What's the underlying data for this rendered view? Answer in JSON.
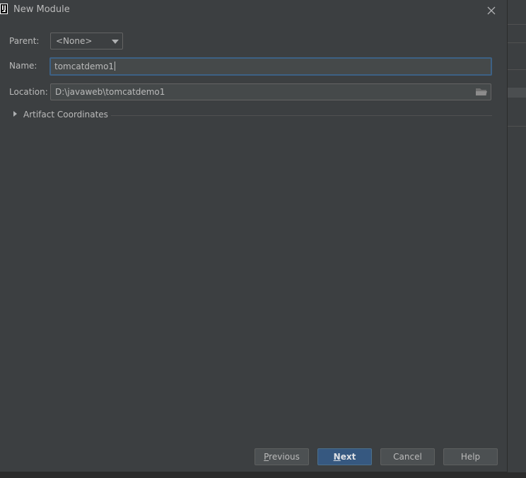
{
  "window": {
    "title": "New Module",
    "app_icon": "intellij-logo-icon"
  },
  "form": {
    "parent_label": "Parent:",
    "parent_value": "<None>",
    "name_label": "Name:",
    "name_value": "tomcatdemo1",
    "location_label": "Location:",
    "location_value": "D:\\javaweb\\tomcatdemo1"
  },
  "sections": {
    "artifact_coordinates": "Artifact Coordinates"
  },
  "buttons": {
    "previous": {
      "pre": "",
      "mnemonic": "P",
      "post": "revious"
    },
    "next": {
      "pre": "",
      "mnemonic": "N",
      "post": "ext"
    },
    "cancel": "Cancel",
    "help": "Help"
  },
  "colors": {
    "dialog_bg": "#3c3f41",
    "input_bg": "#45494a",
    "focus_border": "#3d6185",
    "primary_button": "#365880"
  }
}
